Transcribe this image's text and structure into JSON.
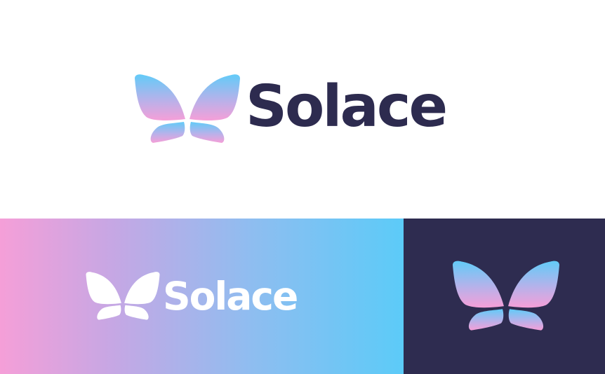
{
  "brand": {
    "name": "Solace",
    "mark_icon": "butterfly-icon"
  },
  "panels": {
    "top": {
      "background": "#ffffff",
      "wordmark_color": "#2d2b4f"
    },
    "gradient": {
      "gradient_start": "#f59fd8",
      "gradient_end": "#5ccbf8",
      "wordmark_color": "#ffffff"
    },
    "dark": {
      "background": "#2e2c50"
    }
  },
  "mark_gradient": {
    "top": "#62cbf8",
    "bottom": "#f59fd8"
  }
}
